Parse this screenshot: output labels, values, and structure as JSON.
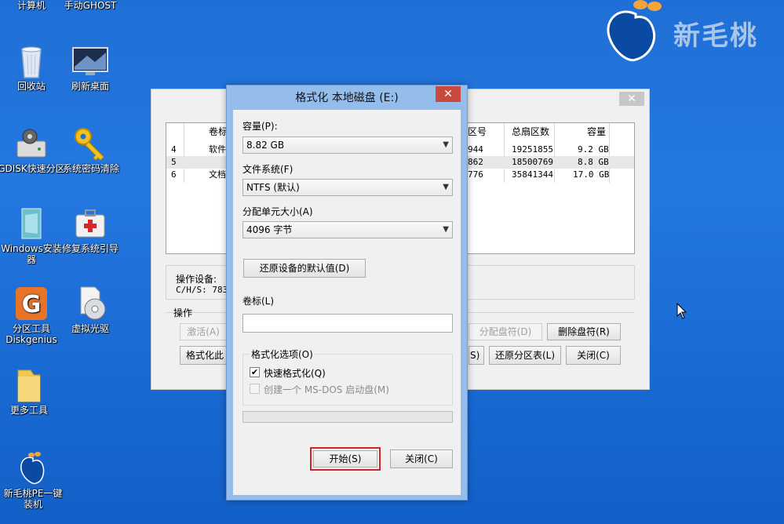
{
  "desktop": {
    "icons": [
      {
        "label": "计算机"
      },
      {
        "label": "手动GHOST"
      },
      {
        "label": "回收站"
      },
      {
        "label": "刷新桌面"
      },
      {
        "label": "GDISK快速分区"
      },
      {
        "label": "系统密码清除"
      },
      {
        "label": "Windows安装器"
      },
      {
        "label": "修复系统引导"
      },
      {
        "label": "分区工具Diskgenius"
      },
      {
        "label": "虚拟光驱"
      },
      {
        "label": "更多工具"
      },
      {
        "label": "新毛桃PE一键装机"
      }
    ],
    "brand_text": "新毛桃"
  },
  "bg_window": {
    "close": "✕",
    "table": {
      "headers": [
        "卷标",
        "区号",
        "总扇区数",
        "容量"
      ],
      "rows": [
        {
          "num": "4",
          "label": "软件",
          "sector": "944",
          "total": "19251855",
          "size": "9.2 GB"
        },
        {
          "num": "5",
          "label": "",
          "sector": "862",
          "total": "18500769",
          "size": "8.8 GB"
        },
        {
          "num": "6",
          "label": "文档",
          "sector": "776",
          "total": "35841344",
          "size": "17.0 GB"
        }
      ]
    },
    "device_label": "操作设备:",
    "device_value": "C/H/S: 7832",
    "ops_label": "操作",
    "buttons": {
      "activate": "激活(A)",
      "format": "格式化此",
      "assign": "分配盘符(D)",
      "delete_letter": "删除盘符(R)",
      "s": "S)",
      "restore": "还原分区表(L)",
      "close": "关闭(C)"
    }
  },
  "dialog": {
    "title": "格式化 本地磁盘 (E:)",
    "close": "✕",
    "capacity_label": "容量(P):",
    "capacity_value": "8.82 GB",
    "fs_label": "文件系统(F)",
    "fs_value": "NTFS (默认)",
    "alloc_label": "分配单元大小(A)",
    "alloc_value": "4096 字节",
    "restore_defaults": "还原设备的默认值(D)",
    "volume_label": "卷标(L)",
    "volume_value": "",
    "options_title": "格式化选项(O)",
    "quick_format": "快速格式化(Q)",
    "quick_format_checked": true,
    "msdos": "创建一个 MS-DOS 启动盘(M)",
    "msdos_checked": false,
    "progress": 0,
    "start": "开始(S)",
    "close_btn": "关闭(C)"
  }
}
